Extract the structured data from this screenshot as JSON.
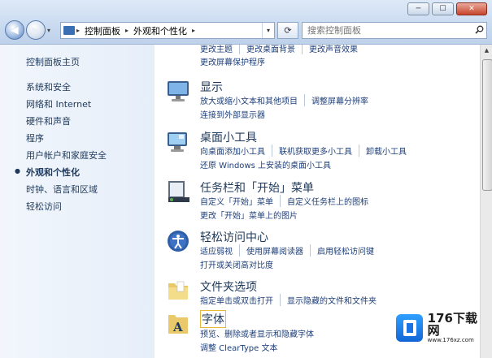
{
  "window": {
    "buttons": {
      "minimize": "─",
      "maximize": "☐",
      "close": "✕"
    }
  },
  "nav": {
    "back": "◀",
    "forward": "▶",
    "dropdown": "▾"
  },
  "address": {
    "segments": [
      "控制面板",
      "外观和个性化"
    ],
    "separator": "▸"
  },
  "refresh_glyph": "⟳",
  "search": {
    "placeholder": "搜索控制面板",
    "icon": "search-icon"
  },
  "sidebar": {
    "items": [
      {
        "label": "控制面板主页"
      },
      {
        "label": "系统和安全"
      },
      {
        "label": "网络和 Internet"
      },
      {
        "label": "硬件和声音"
      },
      {
        "label": "程序"
      },
      {
        "label": "用户帐户和家庭安全"
      },
      {
        "label": "外观和个性化",
        "current": true
      },
      {
        "label": "时钟、语言和区域"
      },
      {
        "label": "轻松访问"
      }
    ]
  },
  "categories": [
    {
      "title": "",
      "links_row1": [
        "更改主题",
        "更改桌面背景",
        "更改声音效果"
      ],
      "links_row2": [
        "更改屏幕保护程序"
      ]
    },
    {
      "title": "显示",
      "icon": "display-icon",
      "links_row1": [
        "放大或缩小文本和其他项目",
        "调整屏幕分辨率"
      ],
      "links_row2": [
        "连接到外部显示器"
      ]
    },
    {
      "title": "桌面小工具",
      "icon": "gadgets-icon",
      "links_row1": [
        "向桌面添加小工具",
        "联机获取更多小工具",
        "卸载小工具"
      ],
      "links_row2": [
        "还原 Windows 上安装的桌面小工具"
      ]
    },
    {
      "title": "任务栏和「开始」菜单",
      "icon": "taskbar-icon",
      "links_row1": [
        "自定义「开始」菜单",
        "自定义任务栏上的图标"
      ],
      "links_row2": [
        "更改「开始」菜单上的图片"
      ]
    },
    {
      "title": "轻松访问中心",
      "icon": "ease-of-access-icon",
      "links_row1": [
        "适应弱视",
        "使用屏幕阅读器",
        "启用轻松访问键"
      ],
      "links_row2": [
        "打开或关闭高对比度"
      ]
    },
    {
      "title": "文件夹选项",
      "icon": "folder-options-icon",
      "links_row1": [
        "指定单击或双击打开",
        "显示隐藏的文件和文件夹"
      ],
      "links_row2": []
    },
    {
      "title": "字体",
      "icon": "fonts-icon",
      "links_row1": [
        "预览、删除或者显示和隐藏字体"
      ],
      "links_row2": [
        "调整 ClearType 文本"
      ]
    }
  ],
  "watermark": {
    "brand": "176下载网",
    "url": "www.176xz.com"
  }
}
